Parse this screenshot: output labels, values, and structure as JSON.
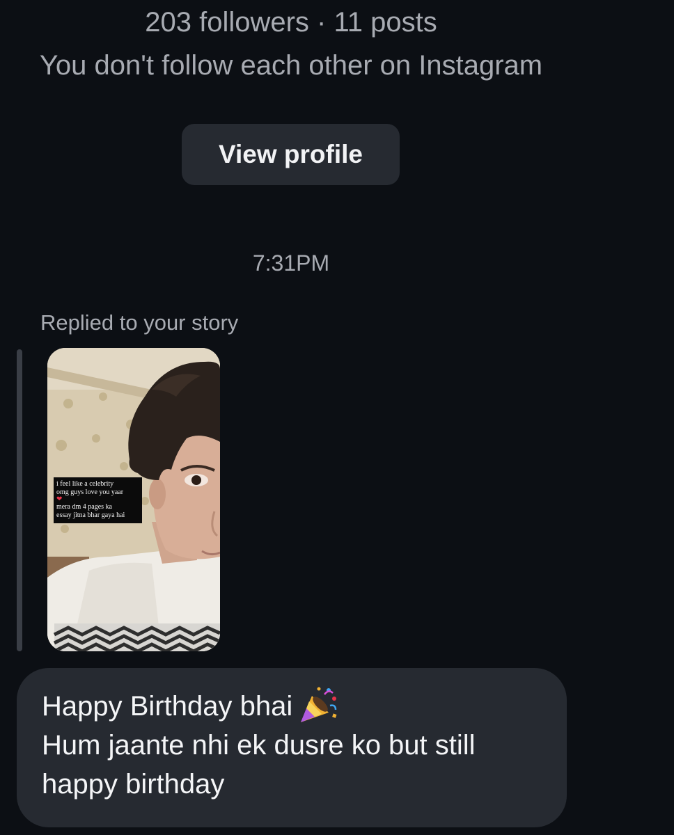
{
  "profile": {
    "stats": "203 followers · 11 posts",
    "mutual_note": "You don't follow each other on Instagram",
    "view_profile_label": "View profile"
  },
  "thread": {
    "timestamp": "7:31PM",
    "reply_label": "Replied to your story",
    "story": {
      "caption_lines": [
        "i feel like a celebrity",
        "omg guys love you yaar",
        "mera dm  4 pages ka",
        "essay jitna bhar gaya hai"
      ]
    },
    "message": {
      "line1": "Happy Birthday bhai",
      "line1_icon": "party-popper-icon",
      "line2": "Hum jaante nhi ek dusre ko but still",
      "line3": "happy birthday"
    }
  },
  "colors": {
    "background": "#0c0f14",
    "bubble": "#262a31",
    "muted_text": "#a8abb2",
    "text": "#f4f5f7"
  }
}
